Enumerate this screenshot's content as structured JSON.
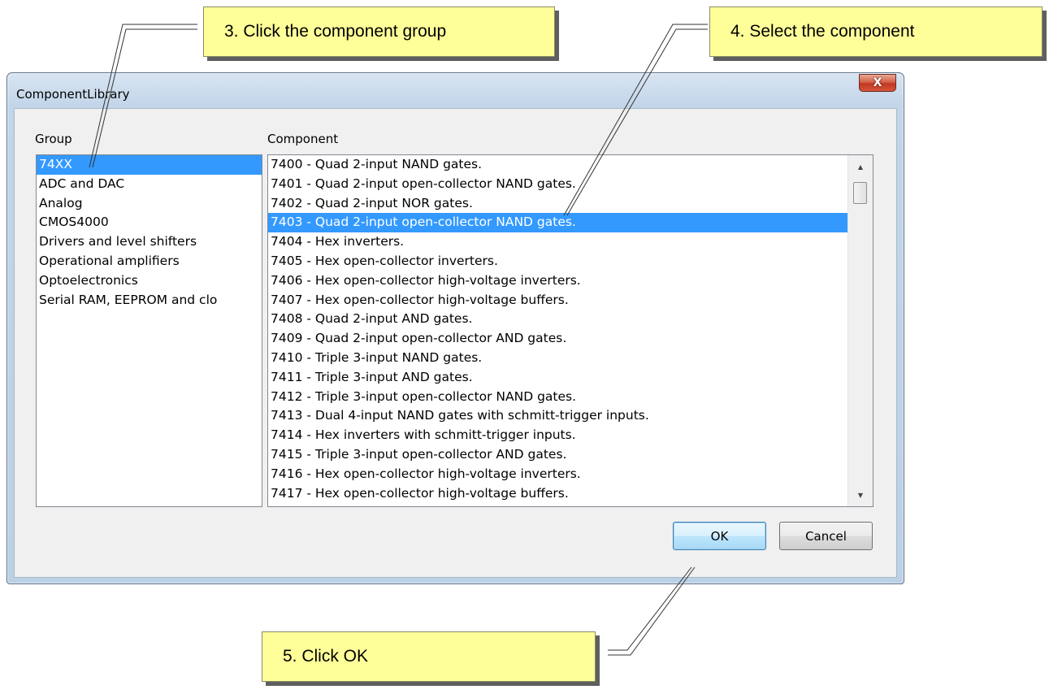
{
  "window": {
    "title": "ComponentLibrary",
    "close_glyph": "X"
  },
  "group_panel": {
    "label": "Group",
    "items": [
      "74XX",
      "ADC and DAC",
      "Analog",
      "CMOS4000",
      "Drivers and level shifters",
      "Operational amplifiers",
      "Optoelectronics",
      "Serial RAM, EEPROM and clo"
    ],
    "selected_index": 0
  },
  "component_panel": {
    "label": "Component",
    "items": [
      "7400 - Quad 2-input NAND gates.",
      "7401 - Quad 2-input open-collector NAND gates.",
      "7402 - Quad 2-input NOR gates.",
      "7403 - Quad 2-input open-collector NAND gates.",
      "7404 - Hex inverters.",
      "7405 - Hex open-collector inverters.",
      "7406 - Hex open-collector high-voltage inverters.",
      "7407 - Hex open-collector high-voltage buffers.",
      "7408 - Quad 2-input AND gates.",
      "7409 - Quad 2-input open-collector AND gates.",
      "7410 - Triple 3-input NAND gates.",
      "7411 - Triple 3-input AND gates.",
      "7412 - Triple 3-input open-collector NAND gates.",
      "7413 - Dual 4-input NAND gates with schmitt-trigger inputs.",
      "7414 - Hex inverters with schmitt-trigger inputs.",
      "7415 - Triple 3-input open-collector AND gates.",
      "7416 - Hex open-collector high-voltage inverters.",
      "7417 - Hex open-collector high-voltage buffers."
    ],
    "selected_index": 3,
    "scroll_up_glyph": "▲",
    "scroll_down_glyph": "▼"
  },
  "buttons": {
    "ok": "OK",
    "cancel": "Cancel"
  },
  "callouts": {
    "step3": "3. Click the component group",
    "step4": "4. Select the component",
    "step5": "5. Click OK"
  },
  "colors": {
    "selection": "#3399ff",
    "callout_fill": "#ffff99",
    "close_button": "#c8442a"
  }
}
